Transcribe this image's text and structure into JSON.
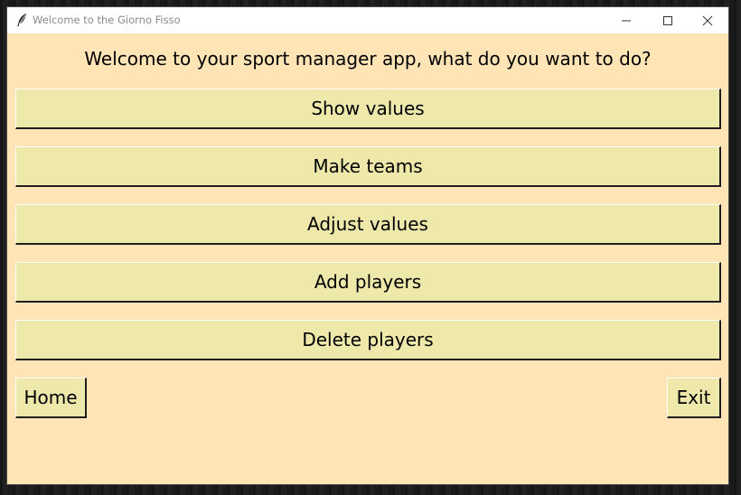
{
  "window": {
    "title": "Welcome to the Giorno Fisso",
    "app_icon": "feather-icon",
    "controls": {
      "minimize_icon": "minimize-icon",
      "maximize_icon": "maximize-icon",
      "close_icon": "close-icon"
    }
  },
  "main": {
    "heading": "Welcome to your sport manager app, what do you want to do?",
    "buttons": [
      {
        "label": "Show values"
      },
      {
        "label": "Make teams"
      },
      {
        "label": "Adjust values"
      },
      {
        "label": "Add players"
      },
      {
        "label": "Delete players"
      }
    ]
  },
  "footer": {
    "home_label": "Home",
    "exit_label": "Exit"
  },
  "colors": {
    "window_background": "#ffe4b5",
    "button_background": "#eee8aa",
    "titlebar_background": "#ffffff"
  }
}
